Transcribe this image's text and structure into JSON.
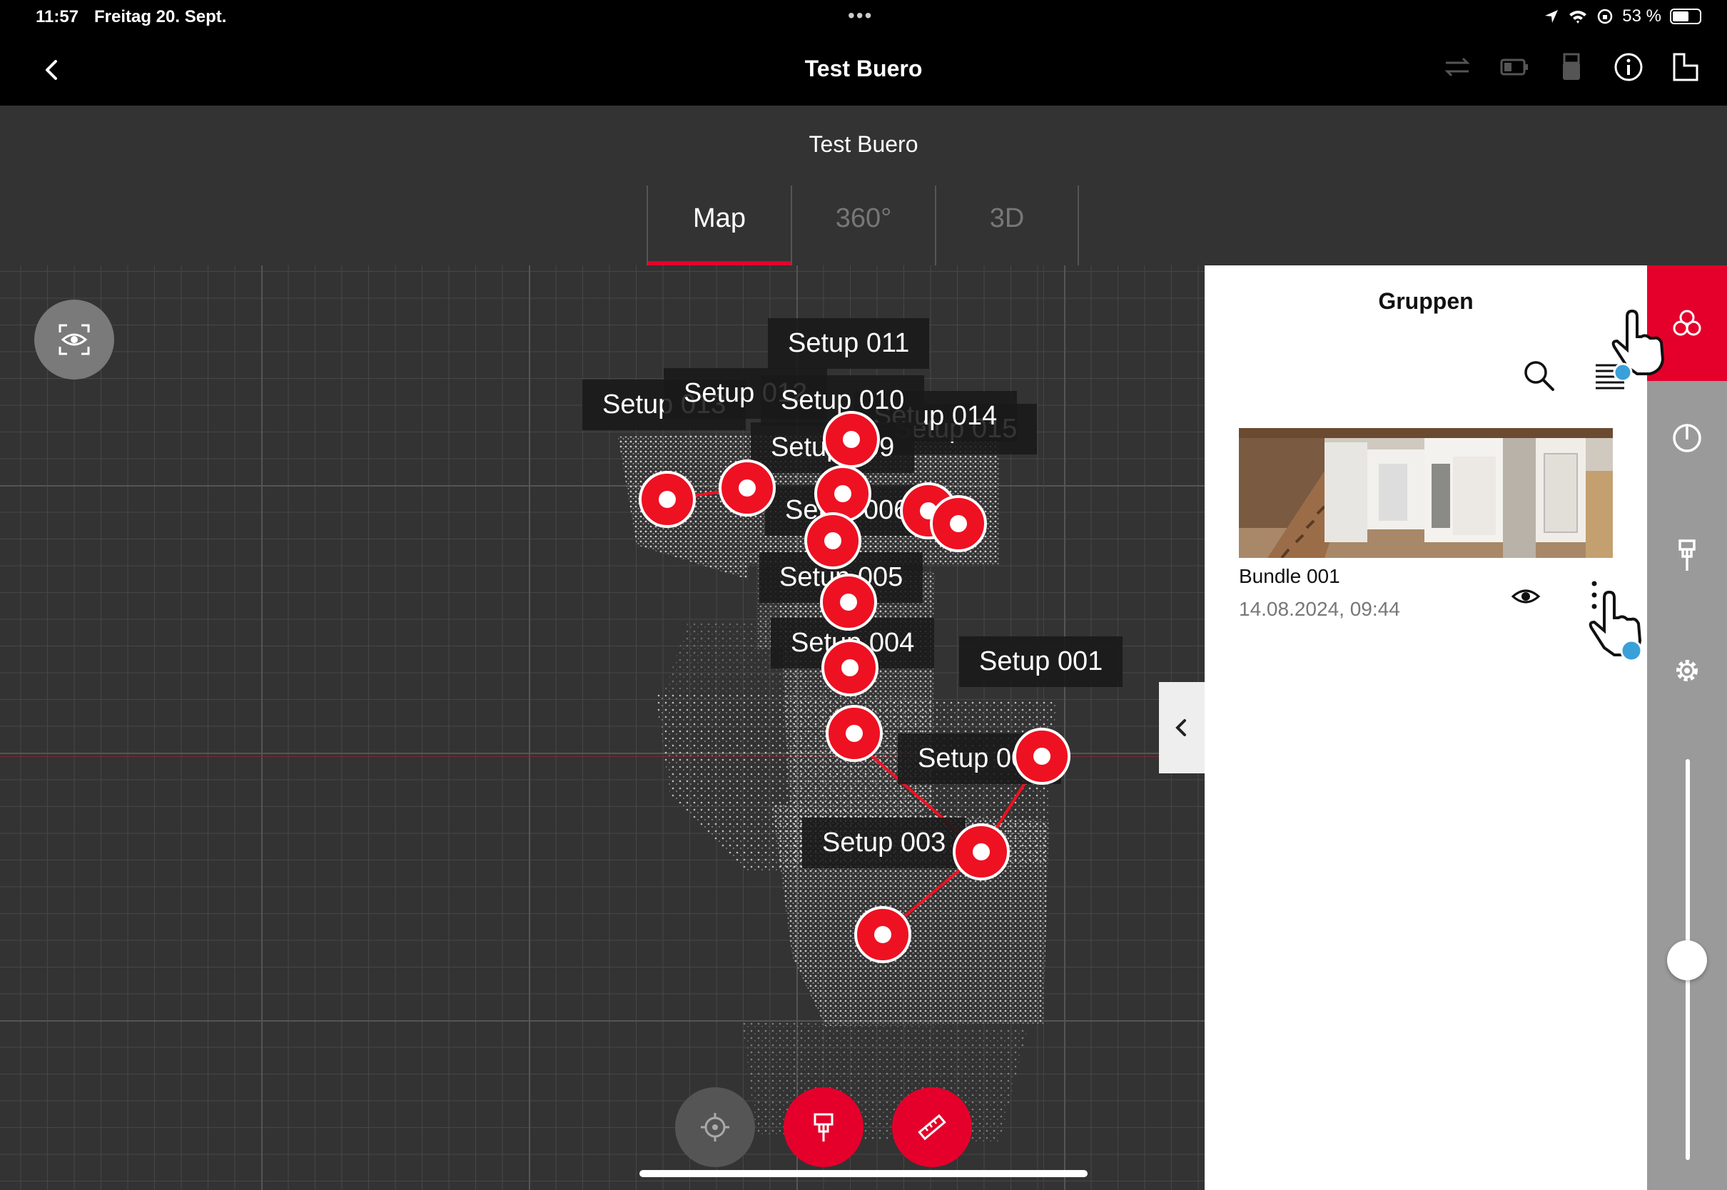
{
  "status": {
    "time": "11:57",
    "date": "Freitag 20. Sept.",
    "battery": "53 %"
  },
  "nav": {
    "title": "Test Buero"
  },
  "project": {
    "title": "Test Buero"
  },
  "tabs": [
    {
      "label": "Map"
    },
    {
      "label": "360°"
    },
    {
      "label": "3D"
    }
  ],
  "map": {
    "labels": {
      "s011": "Setup 011",
      "s013": "Setup 013",
      "s012": "Setup 012",
      "s010": "Setup 010",
      "s014": "Setup 014",
      "s015": "Setup 015",
      "s009": "Setup 009",
      "s006": "Setup 006",
      "s005": "Setup 005",
      "s004": "Setup 004",
      "s001": "Setup 001",
      "s002": "Setup 002",
      "s003": "Setup 003"
    }
  },
  "panel": {
    "title": "Gruppen",
    "bundle": {
      "name": "Bundle 001",
      "date": "14.08.2024, 09:44"
    }
  },
  "colors": {
    "accent": "#e4002b",
    "marker": "#ee1122"
  }
}
